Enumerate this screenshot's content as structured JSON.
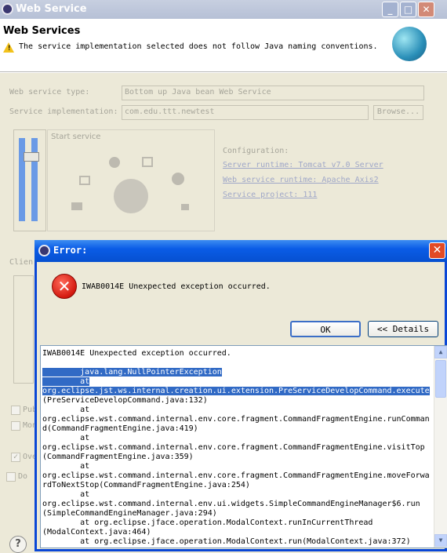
{
  "window": {
    "title": "Web Service",
    "controls": [
      "_",
      "□",
      "✕"
    ]
  },
  "header": {
    "heading": "Web Services",
    "warning": "The service implementation selected does not follow Java naming conventions."
  },
  "form": {
    "service_type_label": "Web service type:",
    "service_type_value": "Bottom up Java bean Web Service",
    "impl_label": "Service implementation:",
    "impl_value": "com.edu.ttt.newtest",
    "browse_label": "Browse...",
    "start_service_label": "Start service",
    "configuration_label": "Configuration:",
    "server_runtime": "Server runtime: Tomcat v7.0 Server",
    "ws_runtime": "Web service runtime: Apache Axis2",
    "service_project": "Service project: 111",
    "client_label": "Clien",
    "pub_label": "Pub",
    "mon_label": "Mon",
    "ove_label": "Ove",
    "do_label": "Do"
  },
  "dialog": {
    "title": "Error:",
    "message": "IWAB0014E Unexpected exception occurred.",
    "ok_label": "OK",
    "details_label": "<< Details",
    "details_lines": [
      {
        "text": "IWAB0014E Unexpected exception occurred.",
        "hl": false
      },
      {
        "text": "",
        "hl": false
      },
      {
        "text": "        java.lang.NullPointerException",
        "hl": true
      },
      {
        "text": "        at",
        "hl": true
      },
      {
        "text": "org.eclipse.jst.ws.internal.creation.ui.extension.PreServiceDevelopCommand.execute",
        "hl": true
      },
      {
        "text": "(PreServiceDevelopCommand.java:132)",
        "hl": false
      },
      {
        "text": "        at",
        "hl": false
      },
      {
        "text": "org.eclipse.wst.command.internal.env.core.fragment.CommandFragmentEngine.runComman",
        "hl": false
      },
      {
        "text": "d(CommandFragmentEngine.java:419)",
        "hl": false
      },
      {
        "text": "        at",
        "hl": false
      },
      {
        "text": "org.eclipse.wst.command.internal.env.core.fragment.CommandFragmentEngine.visitTop",
        "hl": false
      },
      {
        "text": "(CommandFragmentEngine.java:359)",
        "hl": false
      },
      {
        "text": "        at",
        "hl": false
      },
      {
        "text": "org.eclipse.wst.command.internal.env.core.fragment.CommandFragmentEngine.moveForwa",
        "hl": false
      },
      {
        "text": "rdToNextStop(CommandFragmentEngine.java:254)",
        "hl": false
      },
      {
        "text": "        at",
        "hl": false
      },
      {
        "text": "org.eclipse.wst.command.internal.env.ui.widgets.SimpleCommandEngineManager$6.run",
        "hl": false
      },
      {
        "text": "(SimpleCommandEngineManager.java:294)",
        "hl": false
      },
      {
        "text": "        at org.eclipse.jface.operation.ModalContext.runInCurrentThread",
        "hl": false
      },
      {
        "text": "(ModalContext.java:464)",
        "hl": false
      },
      {
        "text": "        at org.eclipse.jface.operation.ModalContext.run(ModalContext.java:372)",
        "hl": false
      }
    ]
  },
  "help_label": "?"
}
